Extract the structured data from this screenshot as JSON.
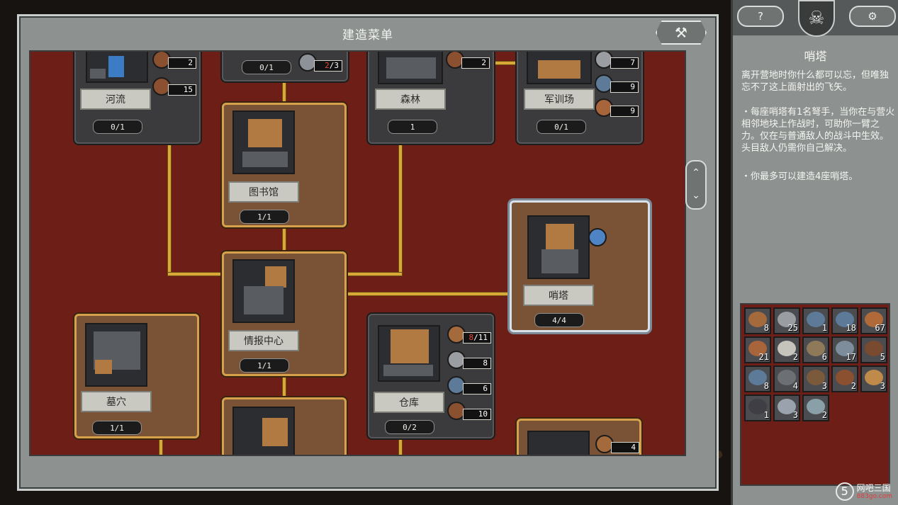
{
  "menu": {
    "title": "建造菜单",
    "close_icon": "hammer-cross-icon"
  },
  "cards": {
    "river": {
      "name": "河流",
      "count": "0/1",
      "res": [
        "2",
        "15"
      ]
    },
    "top2": {
      "count": "0/1",
      "res_red": "2",
      "res_rest": "/3"
    },
    "forest": {
      "name": "森林",
      "count": "1",
      "res": [
        "2"
      ]
    },
    "camp": {
      "name": "军训场",
      "count": "0/1",
      "res": [
        "7",
        "9",
        "9"
      ]
    },
    "library": {
      "name": "图书馆",
      "count": "1/1"
    },
    "intel": {
      "name": "情报中心",
      "count": "1/1"
    },
    "watchtower": {
      "name": "哨塔",
      "count": "4/4"
    },
    "crypt": {
      "name": "墓穴",
      "count": "1/1"
    },
    "storage": {
      "name": "仓库",
      "count": "0/2",
      "res_red": "8",
      "res_rest": "/11",
      "res": [
        "8",
        "6",
        "10"
      ]
    },
    "bottom_right": {
      "res": [
        "4"
      ]
    }
  },
  "side": {
    "help_icon": "question-icon",
    "settings_icon": "gears-icon",
    "skull_icon": "skull-icon",
    "title": "哨塔",
    "quote": "离开营地时你什么都可以忘，但唯独忘不了这上面射出的飞矢。",
    "desc1": "・每座哨塔有1名弩手，当你在与营火相邻地块上作战时，可助你一臂之力。仅在与普通敌人的战斗中生效。头目敌人仍需你自己解决。",
    "desc2": "・你最多可以建造4座哨塔。"
  },
  "scroll": {
    "up": "⌃",
    "down": "⌄"
  },
  "inventory": [
    "8",
    "25",
    "1",
    "18",
    "67",
    "21",
    "2",
    "6",
    "17",
    "5",
    "8",
    "4",
    "3",
    "2",
    "3",
    "1",
    "3",
    "2"
  ],
  "watermark": {
    "logo": "5",
    "name": "网吧三国",
    "sub": "883go.com"
  }
}
